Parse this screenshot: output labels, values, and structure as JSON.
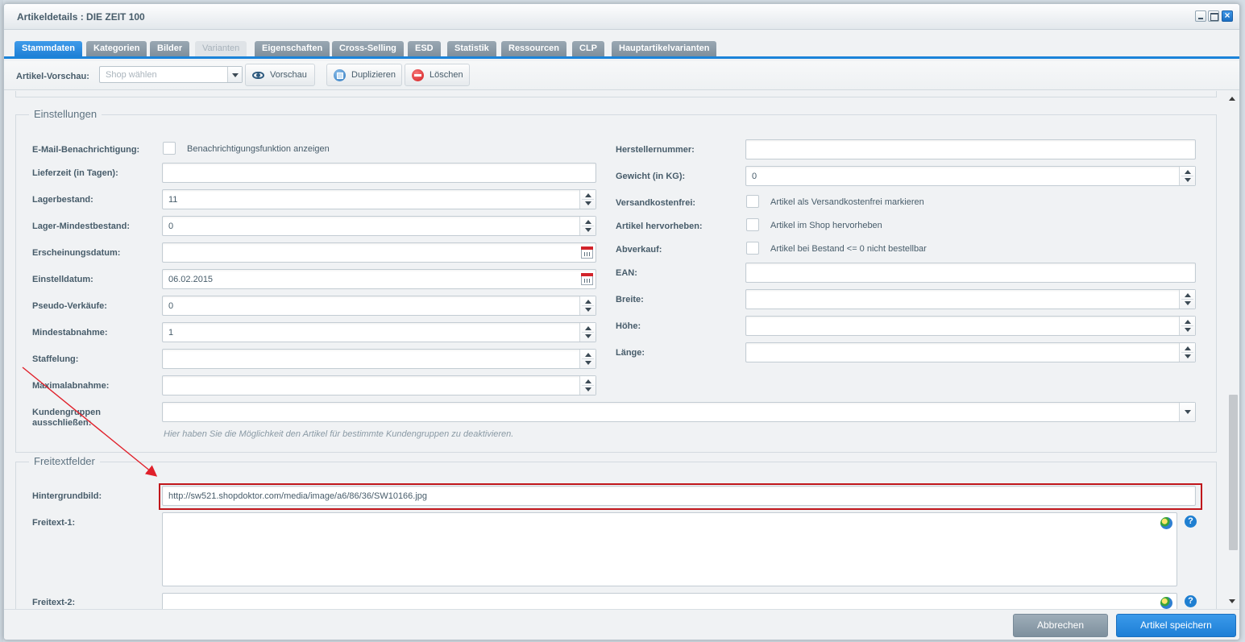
{
  "window": {
    "title": "Artikeldetails : DIE ZEIT 100"
  },
  "tabs": [
    {
      "label": "Stammdaten",
      "state": "active"
    },
    {
      "label": "Kategorien",
      "state": "normal"
    },
    {
      "label": "Bilder",
      "state": "normal"
    },
    {
      "label": "Varianten",
      "state": "disabled"
    },
    {
      "label": "Eigenschaften",
      "state": "normal"
    },
    {
      "label": "Cross-Selling",
      "state": "normal"
    },
    {
      "label": "ESD",
      "state": "normal"
    },
    {
      "label": "Statistik",
      "state": "normal"
    },
    {
      "label": "Ressourcen",
      "state": "normal"
    },
    {
      "label": "CLP",
      "state": "normal"
    },
    {
      "label": "Hauptartikelvarianten",
      "state": "normal"
    }
  ],
  "toolbar": {
    "preview_label": "Artikel-Vorschau:",
    "shop_placeholder": "Shop wählen",
    "preview_button": "Vorschau",
    "duplicate_button": "Duplizieren",
    "delete_button": "Löschen"
  },
  "settings": {
    "legend": "Einstellungen",
    "left": {
      "email_label": "E-Mail-Benachrichtigung:",
      "email_checkbox_label": "Benachrichtigungsfunktion anzeigen",
      "lieferzeit_label": "Lieferzeit (in Tagen):",
      "lieferzeit_value": "",
      "lagerbestand_label": "Lagerbestand:",
      "lagerbestand_value": "11",
      "lagermin_label": "Lager-Mindestbestand:",
      "lagermin_value": "0",
      "erscheinung_label": "Erscheinungsdatum:",
      "erscheinung_value": "",
      "einstell_label": "Einstelldatum:",
      "einstell_value": "06.02.2015",
      "pseudo_label": "Pseudo-Verkäufe:",
      "pseudo_value": "0",
      "mindest_label": "Mindestabnahme:",
      "mindest_value": "1",
      "staffelung_label": "Staffelung:",
      "staffelung_value": "",
      "maximal_label": "Maximalabnahme:",
      "maximal_value": "",
      "kundengruppen_label": "Kundengruppen ausschließen:",
      "kundengruppen_hint": "Hier haben Sie die Möglichkeit den Artikel für bestimmte Kundengruppen zu deaktivieren."
    },
    "right": {
      "hersteller_label": "Herstellernummer:",
      "hersteller_value": "",
      "gewicht_label": "Gewicht (in KG):",
      "gewicht_value": "0",
      "versand_label": "Versandkostenfrei:",
      "versand_checkbox_label": "Artikel als Versandkostenfrei markieren",
      "hervor_label": "Artikel hervorheben:",
      "hervor_checkbox_label": "Artikel im Shop hervorheben",
      "abverkauf_label": "Abverkauf:",
      "abverkauf_checkbox_label": "Artikel bei Bestand <= 0 nicht bestellbar",
      "ean_label": "EAN:",
      "ean_value": "",
      "breite_label": "Breite:",
      "breite_value": "",
      "hoehe_label": "Höhe:",
      "hoehe_value": "",
      "laenge_label": "Länge:",
      "laenge_value": ""
    }
  },
  "freitext": {
    "legend": "Freitextfelder",
    "hintergrund_label": "Hintergrundbild:",
    "hintergrund_value": "http://sw521.shopdoktor.com/media/image/a6/86/36/SW10166.jpg",
    "freitext1_label": "Freitext-1:",
    "freitext2_label": "Freitext-2:",
    "help_glyph": "?"
  },
  "footer": {
    "cancel_button": "Abbrechen",
    "save_button": "Artikel speichern"
  },
  "colors": {
    "accent": "#1f80d6",
    "highlight": "#c0161b",
    "arrow": "#e0202a"
  }
}
